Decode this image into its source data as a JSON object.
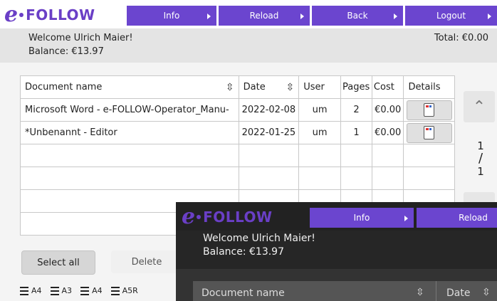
{
  "brand": {
    "logo_letter": "e",
    "logo_text": "FOLLOW",
    "accent": "#6b45cf"
  },
  "nav": {
    "info": "Info",
    "reload": "Reload",
    "back": "Back",
    "logout": "Logout"
  },
  "account": {
    "welcome": "Welcome Ulrich Maier!",
    "balance": "Balance: €13.97",
    "total": "Total: €0.00"
  },
  "table": {
    "headers": {
      "name": "Document name",
      "date": "Date",
      "user": "User",
      "pages": "Pages",
      "cost": "Cost",
      "details": "Details"
    },
    "rows": [
      {
        "name": "Microsoft Word - e-FOLLOW-Operator_Manu-",
        "date": "2022-02-08",
        "user": "um",
        "pages": "2",
        "cost": "€0.00"
      },
      {
        "name": "*Unbenannt - Editor",
        "date": "2022-01-25",
        "user": "um",
        "pages": "1",
        "cost": "€0.00"
      }
    ]
  },
  "pager": {
    "current": "1",
    "total": "1"
  },
  "actions": {
    "select_all": "Select all",
    "delete": "Delete"
  },
  "paper_formats": [
    "A4",
    "A3",
    "A4",
    "A5R"
  ],
  "overlay": {
    "nav": {
      "info": "Info",
      "reload": "Reload"
    },
    "welcome": "Welcome Ulrich Maier!",
    "balance": "Balance: €13.97",
    "headers": {
      "name": "Document name",
      "date": "Date"
    }
  }
}
